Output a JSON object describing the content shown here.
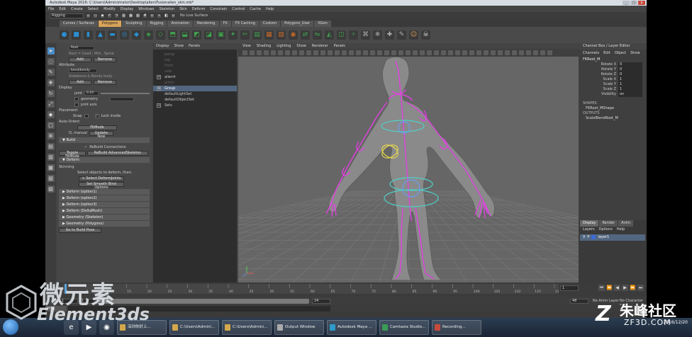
{
  "window": {
    "title": "Autodesk Maya 2016: C:\\Users\\Administrator\\Desktop\\alien\\Fusionalien_skin.mb*",
    "controls": [
      "_",
      "□",
      "x"
    ]
  },
  "menubar": [
    "File",
    "Edit",
    "Create",
    "Select",
    "Modify",
    "Display",
    "Windows",
    "Skeleton",
    "Skin",
    "Deform",
    "Constrain",
    "Control",
    "Cache",
    "Help"
  ],
  "statusline": {
    "mode": "Rigging",
    "live_surface": "No Live Surface"
  },
  "shelf_tabs": [
    {
      "label": "Curves / Surfaces",
      "active": false
    },
    {
      "label": "Polygons",
      "active": true
    },
    {
      "label": "Sculpting",
      "active": false
    },
    {
      "label": "Rigging",
      "active": false
    },
    {
      "label": "Animation",
      "active": false
    },
    {
      "label": "Rendering",
      "active": false
    },
    {
      "label": "FX",
      "active": false
    },
    {
      "label": "FX Caching",
      "active": false
    },
    {
      "label": "Custom",
      "active": false
    },
    {
      "label": "Polygons_User",
      "active": false
    },
    {
      "label": "XGen",
      "active": false
    }
  ],
  "shelf_icons": [
    {
      "name": "poly-sphere-icon",
      "color": "#2a8fd0",
      "glyph": "●"
    },
    {
      "name": "poly-cube-icon",
      "color": "#2a8fd0",
      "glyph": "■"
    },
    {
      "name": "poly-cylinder-icon",
      "color": "#2a8fd0",
      "glyph": "▮"
    },
    {
      "name": "poly-cone-icon",
      "color": "#2a8fd0",
      "glyph": "▲"
    },
    {
      "name": "poly-plane-icon",
      "color": "#2a8fd0",
      "glyph": "▬"
    },
    {
      "name": "poly-torus-icon",
      "color": "#2a8fd0",
      "glyph": "◎"
    },
    {
      "name": "poly-pyramid-icon",
      "color": "#2a8fd0",
      "glyph": "◆"
    },
    {
      "name": "combine-icon",
      "color": "#3fa34d",
      "glyph": "◈"
    },
    {
      "name": "separate-icon",
      "color": "#3fa34d",
      "glyph": "◇"
    },
    {
      "name": "extrude-icon",
      "color": "#3fa34d",
      "glyph": "⬒"
    },
    {
      "name": "bridge-icon",
      "color": "#3fa34d",
      "glyph": "⬓"
    },
    {
      "name": "bevel-icon",
      "color": "#3fa34d",
      "glyph": "◩"
    },
    {
      "name": "merge-icon",
      "color": "#3fa34d",
      "glyph": "◪"
    },
    {
      "name": "fill-hole-icon",
      "color": "#3fa34d",
      "glyph": "▣"
    },
    {
      "name": "smooth-icon",
      "color": "#3fa34d",
      "glyph": "✦"
    },
    {
      "name": "multi-cut-icon",
      "color": "#3fa34d",
      "glyph": "✂"
    },
    {
      "name": "edge-loop-icon",
      "color": "#3fa34d",
      "glyph": "▤"
    },
    {
      "name": "uv-editor-icon",
      "color": "#c66a2a",
      "glyph": "▦"
    },
    {
      "name": "planar-map-icon",
      "color": "#c66a2a",
      "glyph": "▧"
    },
    {
      "name": "soft-select-icon",
      "color": "#c66a2a",
      "glyph": "◉"
    },
    {
      "name": "transfer-icon",
      "color": "#3fa34d",
      "glyph": "⇄"
    },
    {
      "name": "mirror-icon",
      "color": "#3fa34d",
      "glyph": "⇋"
    },
    {
      "name": "triangulate-icon",
      "color": "#3fa34d",
      "glyph": "◭"
    },
    {
      "name": "quadrangulate-icon",
      "color": "#3fa34d",
      "glyph": "◫"
    },
    {
      "name": "cleanup-icon",
      "color": "#3fa34d",
      "glyph": "✧"
    },
    {
      "name": "history-icon",
      "color": "#b0b0b0",
      "glyph": "⌘"
    },
    {
      "name": "freeze-icon",
      "color": "#b0b0b0",
      "glyph": "❄"
    },
    {
      "name": "center-pivot-icon",
      "color": "#b0b0b0",
      "glyph": "✚"
    },
    {
      "name": "script-icon",
      "color": "#b0b0b0",
      "glyph": "✎"
    },
    {
      "name": "face-icon",
      "color": "#e3a35b",
      "glyph": "☺"
    },
    {
      "name": "skull-icon",
      "color": "#dddddd",
      "glyph": "☠"
    }
  ],
  "toolbox_icons": [
    "select-tool-icon",
    "lasso-tool-icon",
    "paint-select-icon",
    "move-tool-icon",
    "rotate-tool-icon",
    "scale-tool-icon",
    "last-tool-icon",
    "single-view-icon",
    "four-view-icon",
    "persp-outliner-icon",
    "graph-layout-icon",
    "hypershade-layout-icon",
    "uv-layout-icon",
    "custom-layout-icon"
  ],
  "attr_panel": {
    "root_label": "Root",
    "add_label": "Add",
    "remove_label": "Remove",
    "attribute_label": "Attribute",
    "attribute_value": "bend/bendy",
    "add2_label": "Add",
    "remove2_label": "Remove",
    "display_label": "Display",
    "joint_label": "joint",
    "joint_value": "0.10",
    "geometry_label": "geometry",
    "joint_axis_label": "joint axis",
    "placement_label": "Placement",
    "snap_label": "Snap",
    "lock_inside_label": "Lock inside",
    "auto_orient_label": "Auto-Orient",
    "fit_mode_label": "FitMode",
    "o_manual_label": "O, manual",
    "update_now_label": "Update Now",
    "build_section": "Build",
    "rebuild_connections": "ReBuild Connections",
    "toggle_fitmode": "Toggle FitMode",
    "rebuild_skeleton": "ReBuild AdvancedSkeleton",
    "deform_section": "Deform",
    "skinning_label": "Skinning",
    "select_objects_hint": "Select objects to deform, then:",
    "select_deformjoints": "+ Select DeformJoints",
    "set_smooth_bind": "Set Smooth Bind Options",
    "deform_items": [
      "Deform (option1)",
      "Deform (option2)",
      "Deform (option3)",
      "Deform (DeltaMush)",
      "Geometry (Skeleton)",
      "Geometry (Polygons)"
    ],
    "go_to_build_pose": "Go to Build Pose"
  },
  "outliner": {
    "menu": [
      "Display",
      "Show",
      "Panels"
    ],
    "items": [
      {
        "label": "persp",
        "faded": true,
        "expand": false,
        "selected": false
      },
      {
        "label": "top",
        "faded": true,
        "expand": false,
        "selected": false
      },
      {
        "label": "front",
        "faded": true,
        "expand": false,
        "selected": false
      },
      {
        "label": "side",
        "faded": true,
        "expand": false,
        "selected": false
      },
      {
        "label": "alien4",
        "faded": false,
        "expand": true,
        "selected": false
      },
      {
        "label": "joints",
        "faded": true,
        "expand": false,
        "selected": false
      },
      {
        "label": "Group",
        "faded": false,
        "expand": true,
        "selected": true
      },
      {
        "label": "defaultLightSet",
        "faded": false,
        "expand": false,
        "selected": false
      },
      {
        "label": "defaultObjectSet",
        "faded": false,
        "expand": false,
        "selected": false
      },
      {
        "label": "Sets",
        "faded": false,
        "expand": true,
        "selected": false
      }
    ]
  },
  "viewport": {
    "menu": [
      "View",
      "Shading",
      "Lighting",
      "Show",
      "Renderer",
      "Panels"
    ],
    "rig_color": "#e040e0",
    "mesh_color": "#8a8a8a",
    "grid_color": "#7a7a7a"
  },
  "channel_box": {
    "title": "Channel Box / Layer Editor",
    "menu": [
      "Channels",
      "Edit",
      "Object",
      "Show"
    ],
    "node": "FKRoot_M",
    "attributes": [
      {
        "name": "Rotate X",
        "value": "0"
      },
      {
        "name": "Rotate Y",
        "value": "0"
      },
      {
        "name": "Rotate Z",
        "value": "0"
      },
      {
        "name": "Scale X",
        "value": "1"
      },
      {
        "name": "Scale Y",
        "value": "1"
      },
      {
        "name": "Scale Z",
        "value": "1"
      },
      {
        "name": "Visibility",
        "value": "on"
      }
    ],
    "shapes_label": "SHAPES",
    "shape_node": "FKRoot_MShape",
    "outputs_label": "OUTPUTS",
    "output_node": "ScaleBlendRoot_M",
    "layer_tabs": [
      "Display",
      "Render",
      "Anim"
    ],
    "layer_menu": [
      "Layers",
      "Options",
      "Help"
    ],
    "layer_name": "layer1"
  },
  "timeslider": {
    "current_frame": "1",
    "playback_buttons": [
      "⏮",
      "⏪",
      "◀",
      "▶",
      "⏩",
      "⏭"
    ],
    "tick_labels": [
      "1",
      "5",
      "10",
      "15",
      "20",
      "25",
      "30",
      "35",
      "40",
      "45",
      "50",
      "55",
      "60",
      "65",
      "70",
      "75",
      "80",
      "85",
      "90",
      "95",
      "100",
      "105",
      "110",
      "115",
      "120"
    ]
  },
  "rangeslider": {
    "start": "1",
    "inner_start": "1",
    "inner_end": "24",
    "end": "48",
    "no_anim_layer": "No Anim Layer",
    "no_character_set": "No Character Set"
  },
  "commandline": {
    "mel_label": "MEL"
  },
  "helpline": {
    "text": ""
  },
  "taskbar": {
    "pinned": [
      {
        "name": "ie-icon",
        "glyph": "e"
      },
      {
        "name": "media-player-icon",
        "glyph": "▶"
      },
      {
        "name": "chrome-icon",
        "glyph": "◉"
      }
    ],
    "tasks": [
      {
        "label": "深圳你好上...",
        "kind": "folder"
      },
      {
        "label": "C:\\Users\\Admini...",
        "kind": "folder"
      },
      {
        "label": "C:\\Users\\Admini...",
        "kind": "folder"
      },
      {
        "label": "Output Window",
        "kind": "out"
      },
      {
        "label": "Autodesk Maya ...",
        "kind": "maya"
      },
      {
        "label": "Camtasia Studio...",
        "kind": "cam"
      },
      {
        "label": "Recording...",
        "kind": "rec"
      }
    ],
    "date": "2016/12/20"
  },
  "watermarks": {
    "left_cn": "微元素",
    "left_en": "Element3ds",
    "right_cn": "朱峰社区",
    "right_en": "ZF3D.COM"
  }
}
